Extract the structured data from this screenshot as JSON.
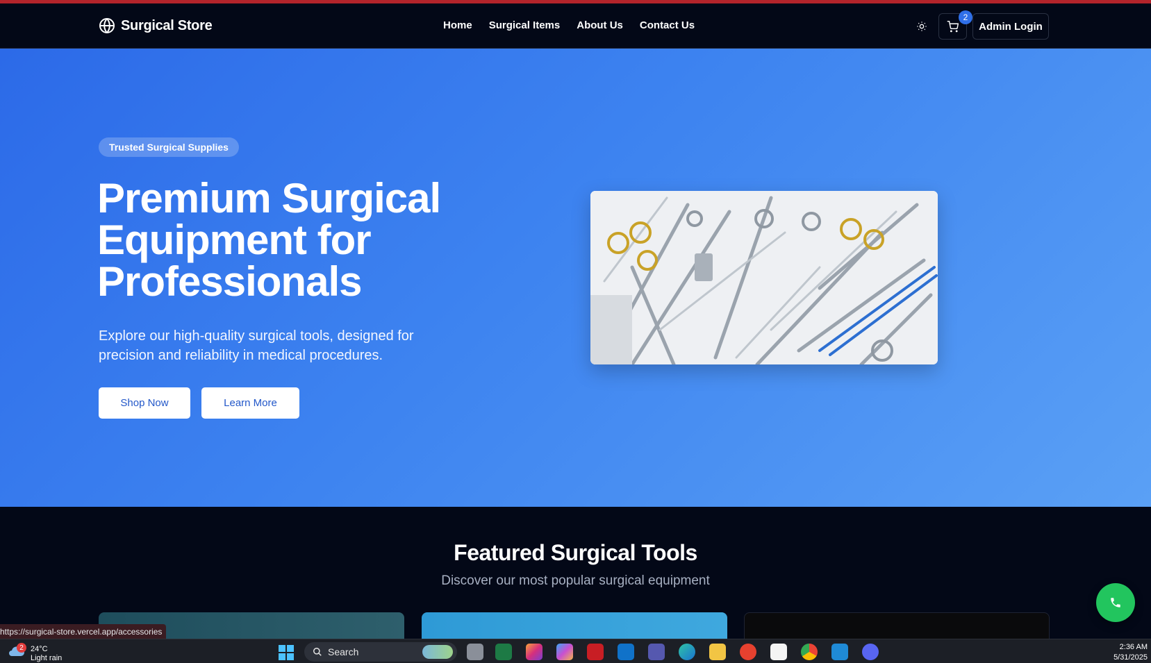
{
  "header": {
    "brand": "Surgical Store",
    "nav": [
      "Home",
      "Surgical Items",
      "About Us",
      "Contact Us"
    ],
    "cart_count": "2",
    "admin_label": "Admin Login"
  },
  "hero": {
    "badge": "Trusted Surgical Supplies",
    "title": "Premium Surgical Equipment for Professionals",
    "description": "Explore our high-quality surgical tools, designed for precision and reliability in medical procedures.",
    "primary_button": "Shop Now",
    "secondary_button": "Learn More"
  },
  "featured": {
    "title": "Featured Surgical Tools",
    "subtitle": "Discover our most popular surgical equipment"
  },
  "status_bar": {
    "url": "https://surgical-store.vercel.app/accessories"
  },
  "taskbar": {
    "weather_badge": "2",
    "temperature": "24°C",
    "condition": "Light rain",
    "search_label": "Search",
    "time": "2:36 AM",
    "date": "5/31/2025"
  },
  "colors": {
    "accent": "#2f6fe8",
    "hero_start": "#2c6ae8",
    "hero_end": "#5aa0f5",
    "call_button": "#22c55e",
    "background": "#030817"
  },
  "icons": [
    "globe-icon",
    "sun-icon",
    "cart-icon",
    "phone-icon",
    "windows-start-icon",
    "search-icon"
  ]
}
